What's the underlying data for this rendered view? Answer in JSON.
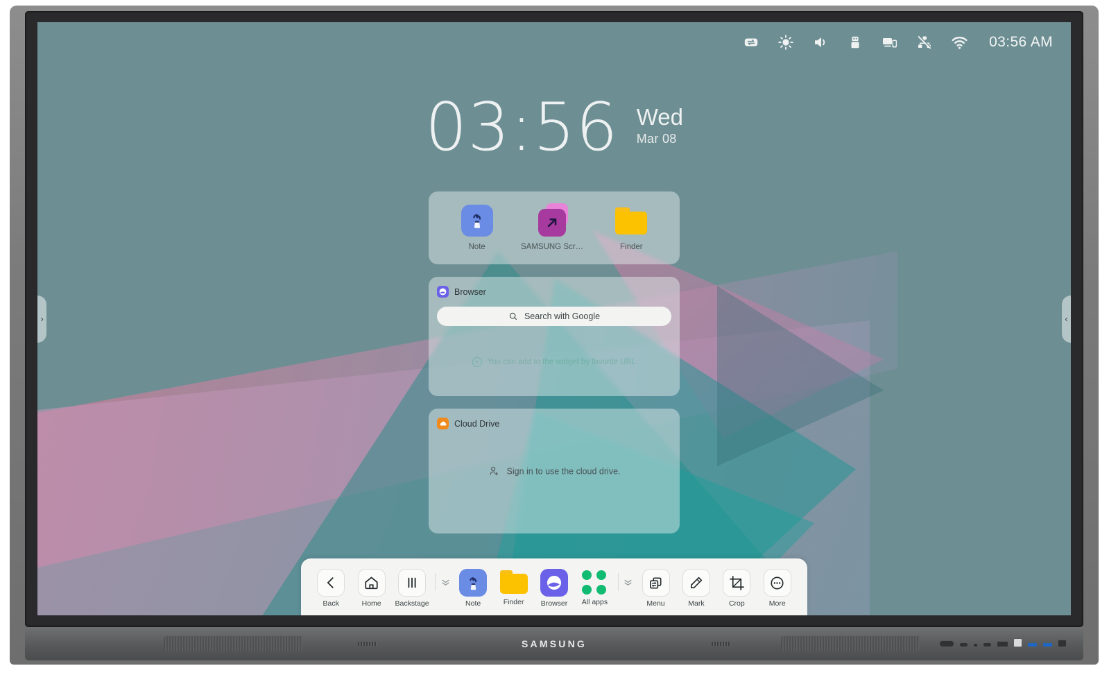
{
  "device": {
    "brand": "SAMSUNG"
  },
  "statusbar": {
    "icons": [
      {
        "name": "input-switch-icon"
      },
      {
        "name": "brightness-icon"
      },
      {
        "name": "volume-icon"
      },
      {
        "name": "usb-icon"
      },
      {
        "name": "screen-share-icon"
      },
      {
        "name": "network-disconnected-icon"
      },
      {
        "name": "wifi-icon"
      }
    ],
    "time": "03:56 AM"
  },
  "clock": {
    "time": "03:56",
    "day": "Wed",
    "date": "Mar 08"
  },
  "shortcuts_widget": {
    "items": [
      {
        "label": "Note",
        "icon": "note-app-icon"
      },
      {
        "label": "SAMSUNG Screen...",
        "icon": "samsung-screen-app-icon"
      },
      {
        "label": "Finder",
        "icon": "finder-app-icon"
      }
    ]
  },
  "browser_widget": {
    "title": "Browser",
    "search_placeholder": "Search with Google",
    "hint": "You can add to the widget by favorite URL"
  },
  "cloud_widget": {
    "title": "Cloud Drive",
    "signin_text": "Sign in to use the cloud drive."
  },
  "side_handles": {
    "left": "›",
    "right": "‹"
  },
  "taskbar": {
    "nav": [
      {
        "label": "Back",
        "icon": "chevron-left-icon"
      },
      {
        "label": "Home",
        "icon": "home-icon"
      },
      {
        "label": "Backstage",
        "icon": "backstage-bars-icon"
      }
    ],
    "collapse_left": "»",
    "apps": [
      {
        "label": "Note",
        "icon": "note-app-icon"
      },
      {
        "label": "Finder",
        "icon": "finder-app-icon"
      },
      {
        "label": "Browser",
        "icon": "browser-app-icon"
      },
      {
        "label": "All apps",
        "icon": "all-apps-grid-icon"
      }
    ],
    "collapse_right": "»",
    "tools": [
      {
        "label": "Menu",
        "icon": "menu-windows-icon"
      },
      {
        "label": "Mark",
        "icon": "pencil-mark-icon"
      },
      {
        "label": "Crop",
        "icon": "crop-icon"
      },
      {
        "label": "More",
        "icon": "more-dots-icon"
      }
    ]
  },
  "colors": {
    "wallpaper_base": "#6d8e93",
    "accent_note": "#6a8ce4",
    "accent_folder": "#fcc200",
    "accent_browser": "#6b61e8",
    "accent_allapps": "#12bb72",
    "accent_screenshot": "#a63a9e",
    "accent_cloud": "#f08a1c",
    "taskbar_bg": "#f4f5f3"
  }
}
